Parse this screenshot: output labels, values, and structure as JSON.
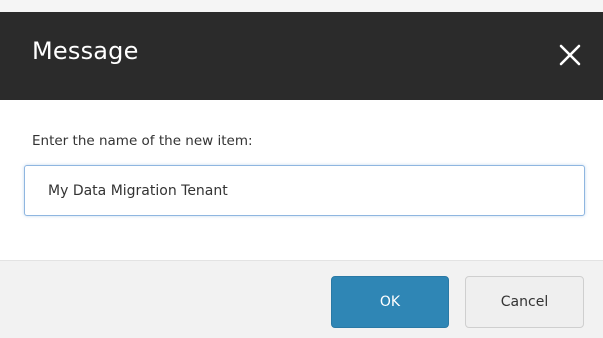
{
  "dialog": {
    "title": "Message",
    "close_icon": "close-icon",
    "prompt": "Enter the name of the new item:",
    "input_value": "My Data Migration Tenant",
    "ok_label": "OK",
    "cancel_label": "Cancel"
  },
  "colors": {
    "title_bar": "#2b2b2b",
    "primary_button": "#2f86b5",
    "secondary_button": "#efefef",
    "input_border": "#8fb6e0"
  }
}
